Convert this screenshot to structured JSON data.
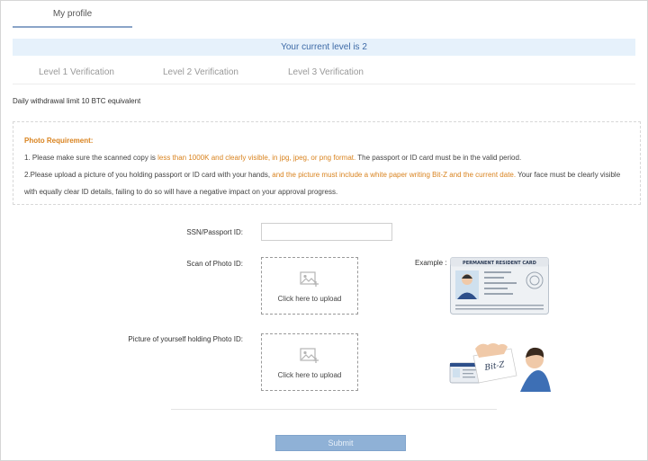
{
  "tabs": {
    "profile": "My profile"
  },
  "level_banner": "Your current level is 2",
  "verification_tabs": [
    "Level 1 Verification",
    "Level 2 Verification",
    "Level 3 Verification"
  ],
  "withdrawal_limit": "Daily withdrawal limit 10 BTC equivalent",
  "requirements": {
    "title": "Photo Requirement:",
    "line1_pre": "1. Please make sure the scanned copy is ",
    "line1_hl": "less than 1000K and clearly visible, in jpg, jpeg, or png format.",
    "line1_post": " The passport or ID card must be in the valid period.",
    "line2_pre": "2.Please upload a picture of you holding passport or ID card with your hands, ",
    "line2_hl": "and the picture must include a white paper writing Bit-Z and the current date.",
    "line2_post": " Your face must be clearly visible",
    "line3": "with equally clear ID details, failing to do so will have a negative impact on your approval progress."
  },
  "form": {
    "ssn_label": "SSN/Passport ID:",
    "ssn_value": "",
    "scan_label": "Scan of Photo ID:",
    "holding_label": "Picture of yourself holding Photo ID:",
    "upload_text": "Click here to upload",
    "example_label": "Example :",
    "card_title": "PERMANENT RESIDENT CARD",
    "paper_text": "Bit-Z"
  },
  "submit_label": "Submit",
  "colors": {
    "accent": "#3d6aa6",
    "banner_bg": "#e6f1fb",
    "highlight": "#d9831f",
    "button_bg": "#8fb1d6"
  }
}
